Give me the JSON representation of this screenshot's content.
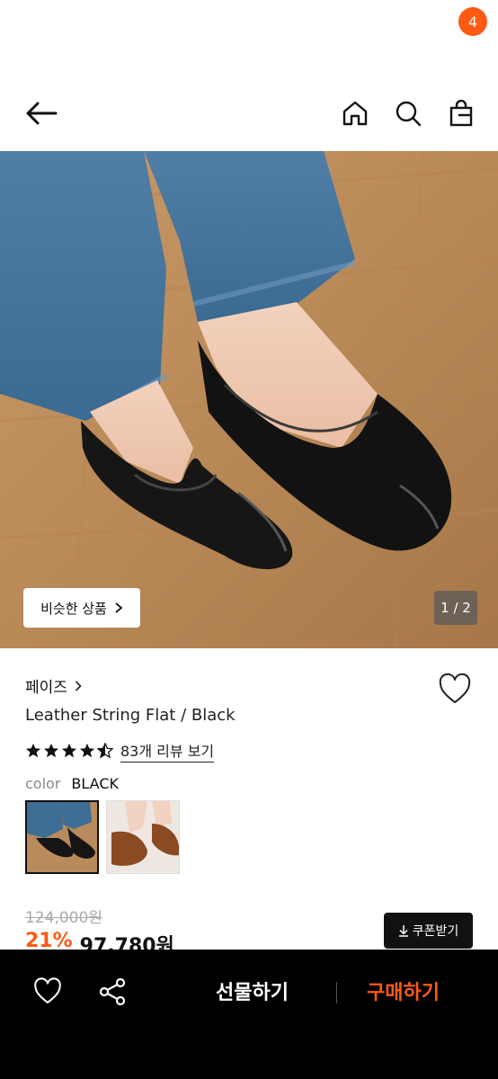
{
  "header": {
    "cart_count": "4"
  },
  "hero": {
    "similar_label": "비슷한 상품",
    "page_indicator": "1 / 2"
  },
  "product": {
    "brand": "페이즈",
    "title": "Leather String Flat / Black",
    "rating_value": 4.5,
    "review_link": "83개 리뷰 보기",
    "color_key": "color",
    "color_value": "BLACK",
    "old_price": "124,000원",
    "discount": "21%",
    "price": "97,780원",
    "coupon_label": "쿠폰받기"
  },
  "bottom_bar": {
    "gift_label": "선물하기",
    "buy_label": "구매하기"
  },
  "colors": {
    "accent": "#ff5a14",
    "bar": "#000000"
  }
}
